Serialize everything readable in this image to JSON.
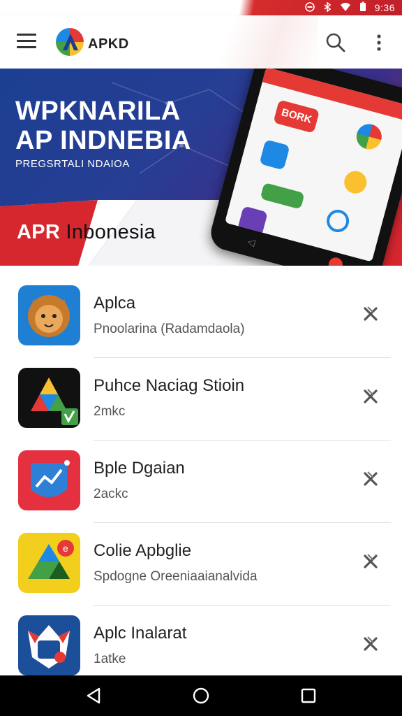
{
  "status_bar": {
    "time": "9:36",
    "icons": [
      "dnd-icon",
      "bluetooth-icon",
      "wifi-icon",
      "battery-icon"
    ]
  },
  "app_bar": {
    "brand": "APKD",
    "icons": [
      "menu-icon",
      "search-icon",
      "more-vert-icon"
    ]
  },
  "banner": {
    "title_line1": "WPKNARILA",
    "title_line2": "AP INDNEBIA",
    "subtitle": "PREGSRTALI NDAIOA",
    "logo_a": "A",
    "logo_pr": "PR",
    "caption": "Inbonesia",
    "phone_label": "BORK"
  },
  "apps": [
    {
      "name": "Aplca",
      "subtitle": "Pnoolarina (Radamdaola)",
      "icon": "lion-icon",
      "color": "#1f7fd2"
    },
    {
      "name": "Puhce Naciag Stioin",
      "subtitle": "2mkc",
      "icon": "play-triangle-icon",
      "color": "#111111"
    },
    {
      "name": "Bple Dgaian",
      "subtitle": "2ackc",
      "icon": "chart-shield-icon",
      "color": "#e53040"
    },
    {
      "name": "Colie Apbglie",
      "subtitle": "Spdogne Oreeniaaianalvida",
      "icon": "triangle-badge-icon",
      "color": "#f2cf1d"
    },
    {
      "name": "Aplc Inalarat",
      "subtitle": "1atke",
      "icon": "emblem-icon",
      "color": "#1c4f9a"
    }
  ],
  "nav_bar": {
    "icons": [
      "back-icon",
      "home-icon",
      "recents-icon"
    ]
  },
  "colors": {
    "brand_red": "#d6262e",
    "brand_blue": "#1c3f92",
    "nav_black": "#000000"
  }
}
